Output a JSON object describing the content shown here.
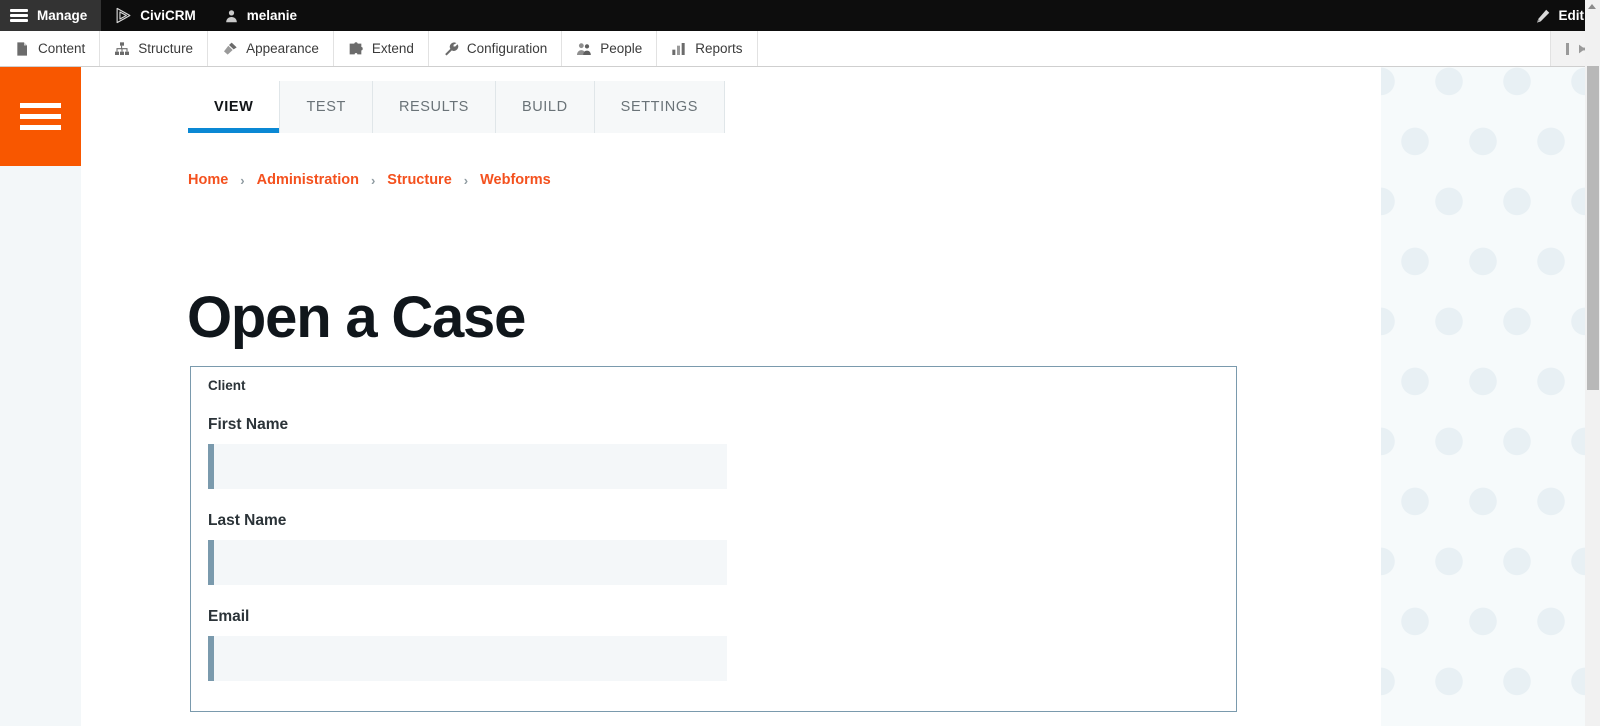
{
  "admin_toolbar": {
    "manage_label": "Manage",
    "manage_icon": "hamburger-icon",
    "items": [
      {
        "label": "CiviCRM",
        "icon": "civicrm-logo-icon"
      },
      {
        "label": "melanie",
        "icon": "user-account-icon"
      }
    ],
    "edit_label": "Edit",
    "edit_icon": "pencil-icon"
  },
  "menu_bar": {
    "items": [
      {
        "label": "Content",
        "icon": "file-page-icon"
      },
      {
        "label": "Structure",
        "icon": "sitemap-icon"
      },
      {
        "label": "Appearance",
        "icon": "paintbrush-icon"
      },
      {
        "label": "Extend",
        "icon": "puzzle-piece-icon"
      },
      {
        "label": "Configuration",
        "icon": "wrench-icon"
      },
      {
        "label": "People",
        "icon": "people-icon"
      },
      {
        "label": "Reports",
        "icon": "bar-chart-icon"
      }
    ],
    "orientation_toggle_icon": "collapse-toolbar-icon"
  },
  "left_rail": {
    "menu_button_icon": "hamburger-menu-icon",
    "accent_color": "#f85700"
  },
  "tabs": {
    "items": [
      {
        "label": "VIEW",
        "active": true
      },
      {
        "label": "TEST",
        "active": false
      },
      {
        "label": "RESULTS",
        "active": false
      },
      {
        "label": "BUILD",
        "active": false
      },
      {
        "label": "SETTINGS",
        "active": false
      }
    ],
    "active_underline_color": "#0a88d4"
  },
  "breadcrumb": {
    "separator": "›",
    "items": [
      {
        "label": "Home"
      },
      {
        "label": "Administration"
      },
      {
        "label": "Structure"
      },
      {
        "label": "Webforms"
      }
    ],
    "link_color": "#f4511e"
  },
  "page": {
    "title": "Open a Case"
  },
  "form": {
    "fieldset_legend": "Client",
    "border_color": "#7a9aad",
    "fields": [
      {
        "label": "First Name",
        "value": "",
        "placeholder": ""
      },
      {
        "label": "Last Name",
        "value": "",
        "placeholder": ""
      },
      {
        "label": "Email",
        "value": "",
        "placeholder": ""
      }
    ]
  },
  "scrollbar": {
    "up_arrow_icon": "scroll-up-arrow-icon"
  }
}
